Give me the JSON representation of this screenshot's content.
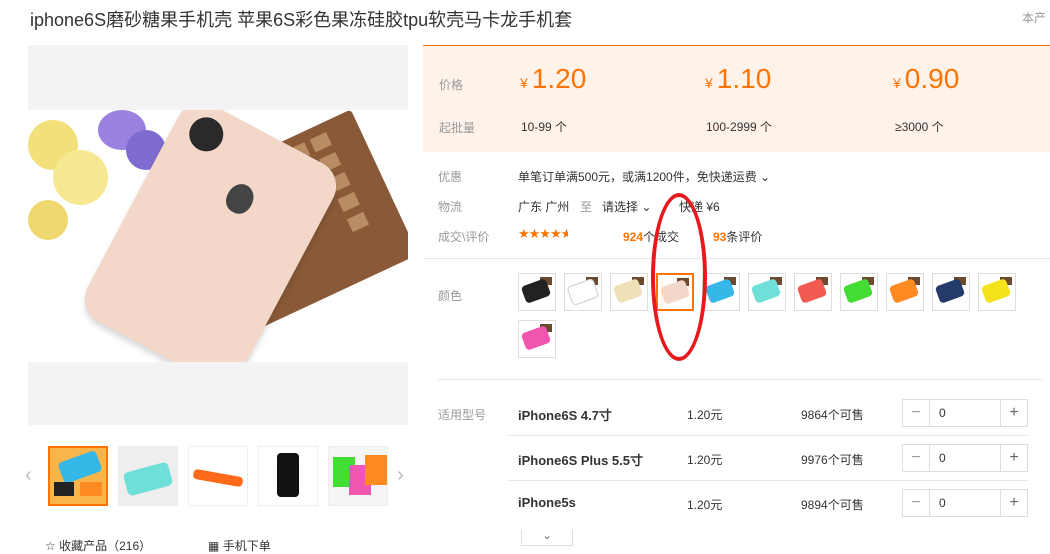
{
  "product": {
    "title": "iphone6S磨砂糖果手机壳 苹果6S彩色果冻硅胶tpu软壳马卡龙手机套",
    "top_right_text": "本产"
  },
  "gallery": {
    "thumbnail_count": 5,
    "prev_icon": "chevron-left-icon",
    "next_icon": "chevron-right-icon",
    "favorite_label": "收藏产品（216）",
    "mobile_order_label": "手机下单"
  },
  "pricing": {
    "price_label": "价格",
    "moq_label": "起批量",
    "tiers": [
      {
        "price": "1.20",
        "quantity": "10-99 个"
      },
      {
        "price": "1.10",
        "quantity": "100-2999 个"
      },
      {
        "price": "0.90",
        "quantity": "≥3000 个"
      }
    ],
    "currency": "¥"
  },
  "promo": {
    "label": "优惠",
    "text": "单笔订单满500元，或满1200件，免快递运费"
  },
  "shipping": {
    "label": "物流",
    "origin": "广东 广州",
    "to": "至",
    "select": "请选择",
    "method": "快递",
    "fee": "¥6"
  },
  "reviews": {
    "label": "成交\\评价",
    "rating": 4.5,
    "deals_count": "924",
    "deals_text": "个成交",
    "review_count": "93",
    "review_text": "条评价"
  },
  "color": {
    "label": "颜色",
    "selected_index": 3,
    "swatches": [
      "#222222",
      "#ffffff",
      "#f0e0b8",
      "#f3d8c9",
      "#35b8e8",
      "#6fe0d8",
      "#f25a52",
      "#44dd33",
      "#ff8a22",
      "#233a6a",
      "#f4e21a",
      "#f055b0"
    ]
  },
  "models": {
    "label": "适用型号",
    "items": [
      {
        "name": "iPhone6S 4.7寸",
        "price": "1.20元",
        "stock": "9864个可售",
        "qty": "0"
      },
      {
        "name": "iPhone6S Plus 5.5寸",
        "price": "1.20元",
        "stock": "9976个可售",
        "qty": "0"
      },
      {
        "name": "iPhone5s",
        "price": "1.20元",
        "stock": "9894个可售",
        "qty": "0"
      }
    ]
  },
  "theme": {
    "accent": "#ff7300",
    "price_bg": "#fff2e8",
    "annotation": "#e8191d"
  }
}
